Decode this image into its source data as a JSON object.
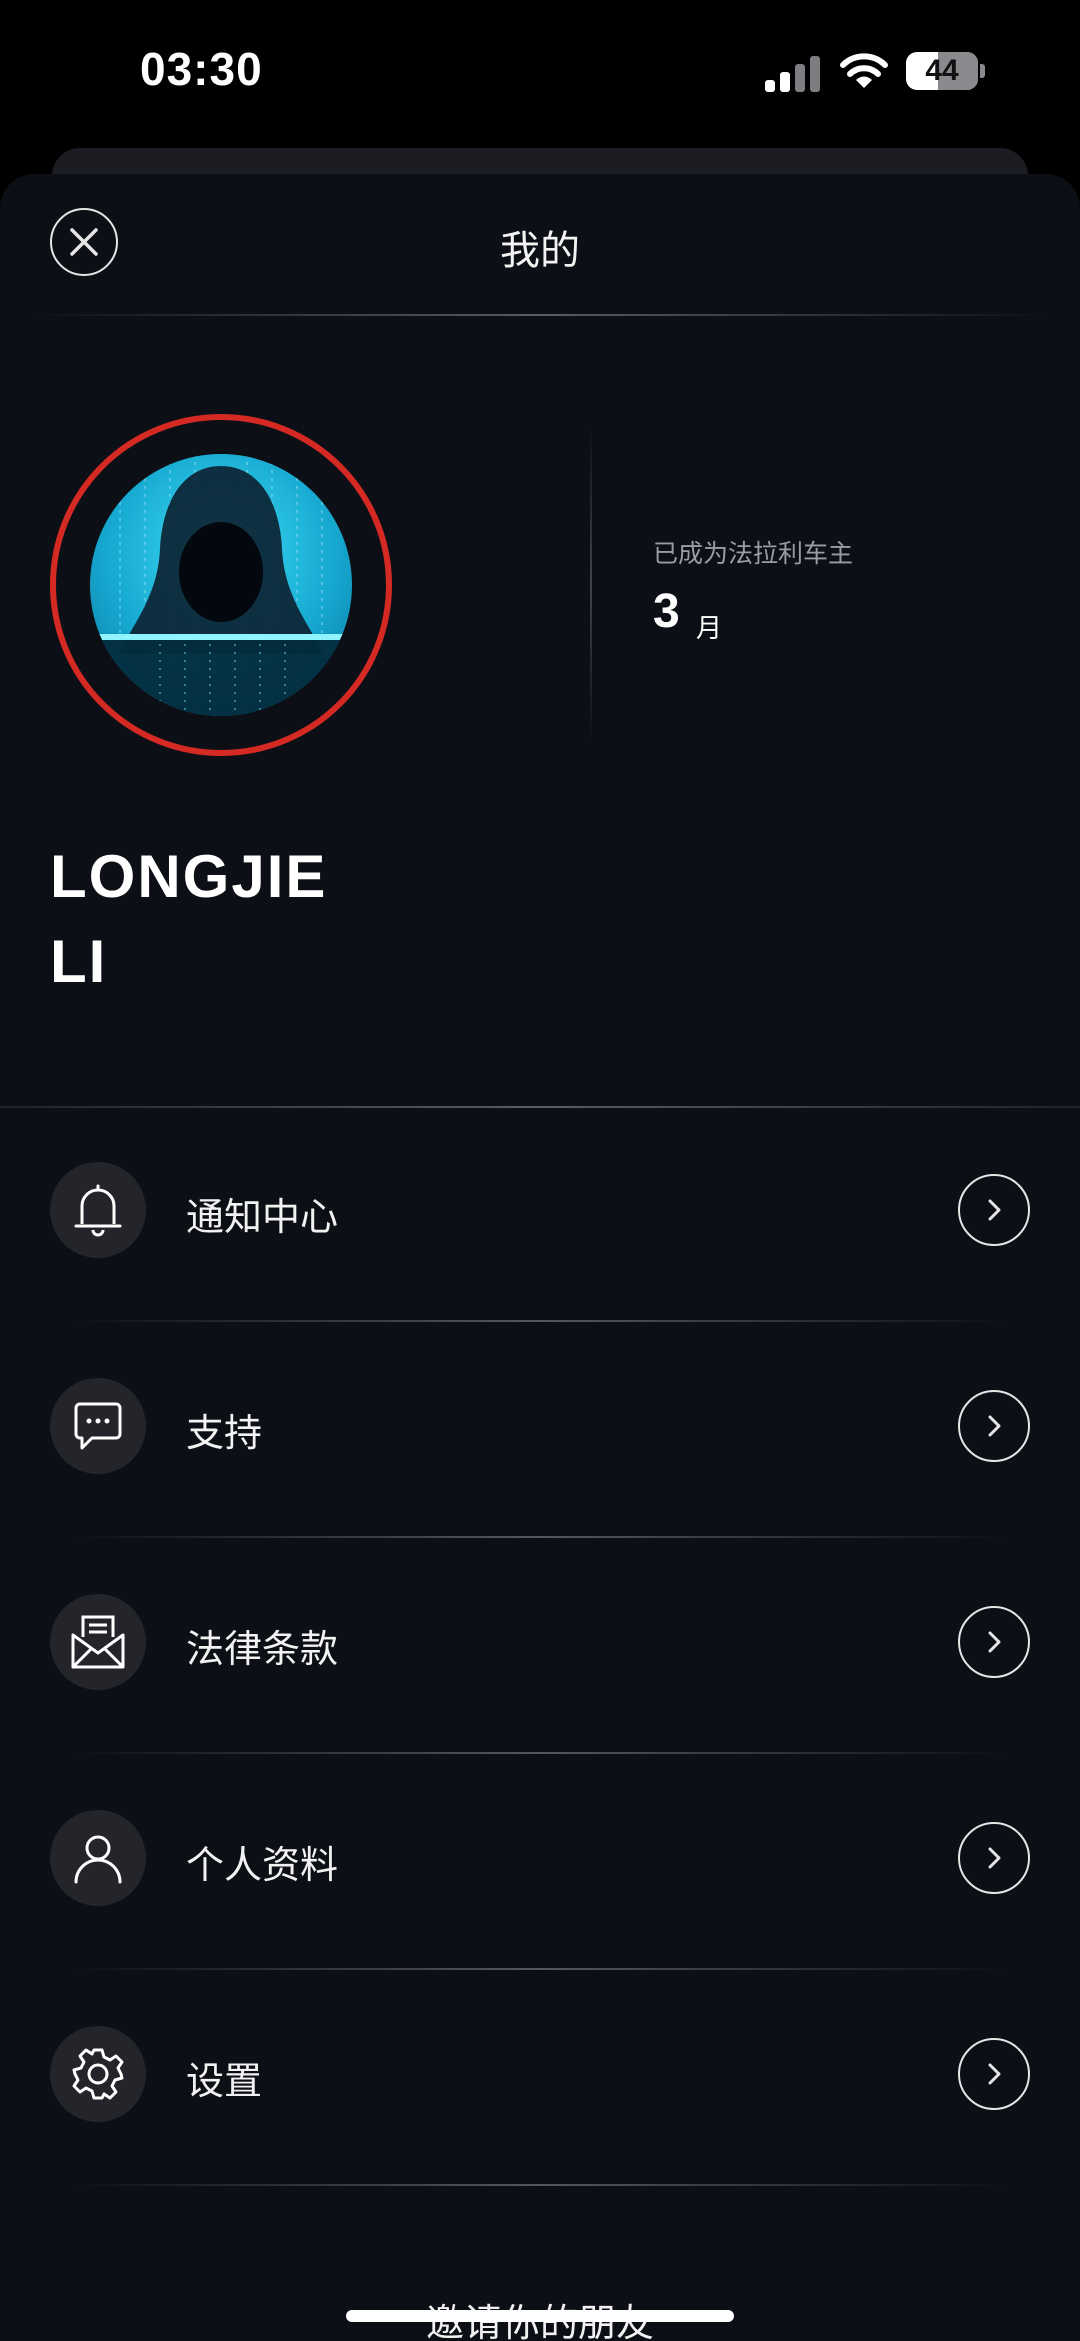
{
  "status_bar": {
    "time": "03:30",
    "battery": "44",
    "battery_level": 0.44
  },
  "header": {
    "title": "我的"
  },
  "profile": {
    "user_name": "LONGJIE\nLI",
    "owner_label": "已成为法拉利车主",
    "owner_value": "3",
    "owner_unit": "月"
  },
  "menu": {
    "items": [
      {
        "label": "通知中心",
        "icon": "bell-icon"
      },
      {
        "label": "支持",
        "icon": "chat-bubble-icon"
      },
      {
        "label": "法律条款",
        "icon": "document-envelope-icon"
      },
      {
        "label": "个人资料",
        "icon": "person-icon"
      },
      {
        "label": "设置",
        "icon": "gear-icon"
      }
    ]
  },
  "footer": {
    "invite": "邀请你的朋友"
  },
  "colors": {
    "background": "#0d0f16",
    "avatar_ring": "#d42a23",
    "avatar_glow": "#3fdcf5"
  }
}
